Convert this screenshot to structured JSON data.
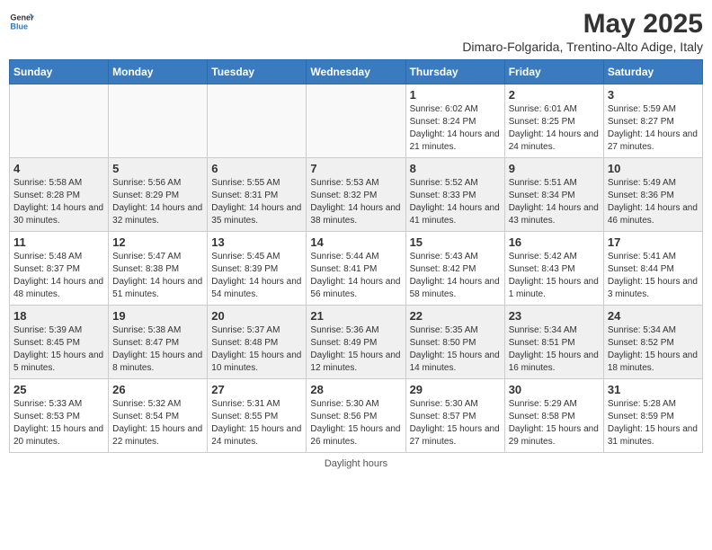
{
  "header": {
    "logo_general": "General",
    "logo_blue": "Blue",
    "title": "May 2025",
    "subtitle": "Dimaro-Folgarida, Trentino-Alto Adige, Italy"
  },
  "days_of_week": [
    "Sunday",
    "Monday",
    "Tuesday",
    "Wednesday",
    "Thursday",
    "Friday",
    "Saturday"
  ],
  "footer": "Daylight hours",
  "weeks": [
    [
      {
        "day": "",
        "info": ""
      },
      {
        "day": "",
        "info": ""
      },
      {
        "day": "",
        "info": ""
      },
      {
        "day": "",
        "info": ""
      },
      {
        "day": "1",
        "info": "Sunrise: 6:02 AM\nSunset: 8:24 PM\nDaylight: 14 hours and 21 minutes."
      },
      {
        "day": "2",
        "info": "Sunrise: 6:01 AM\nSunset: 8:25 PM\nDaylight: 14 hours and 24 minutes."
      },
      {
        "day": "3",
        "info": "Sunrise: 5:59 AM\nSunset: 8:27 PM\nDaylight: 14 hours and 27 minutes."
      }
    ],
    [
      {
        "day": "4",
        "info": "Sunrise: 5:58 AM\nSunset: 8:28 PM\nDaylight: 14 hours and 30 minutes."
      },
      {
        "day": "5",
        "info": "Sunrise: 5:56 AM\nSunset: 8:29 PM\nDaylight: 14 hours and 32 minutes."
      },
      {
        "day": "6",
        "info": "Sunrise: 5:55 AM\nSunset: 8:31 PM\nDaylight: 14 hours and 35 minutes."
      },
      {
        "day": "7",
        "info": "Sunrise: 5:53 AM\nSunset: 8:32 PM\nDaylight: 14 hours and 38 minutes."
      },
      {
        "day": "8",
        "info": "Sunrise: 5:52 AM\nSunset: 8:33 PM\nDaylight: 14 hours and 41 minutes."
      },
      {
        "day": "9",
        "info": "Sunrise: 5:51 AM\nSunset: 8:34 PM\nDaylight: 14 hours and 43 minutes."
      },
      {
        "day": "10",
        "info": "Sunrise: 5:49 AM\nSunset: 8:36 PM\nDaylight: 14 hours and 46 minutes."
      }
    ],
    [
      {
        "day": "11",
        "info": "Sunrise: 5:48 AM\nSunset: 8:37 PM\nDaylight: 14 hours and 48 minutes."
      },
      {
        "day": "12",
        "info": "Sunrise: 5:47 AM\nSunset: 8:38 PM\nDaylight: 14 hours and 51 minutes."
      },
      {
        "day": "13",
        "info": "Sunrise: 5:45 AM\nSunset: 8:39 PM\nDaylight: 14 hours and 54 minutes."
      },
      {
        "day": "14",
        "info": "Sunrise: 5:44 AM\nSunset: 8:41 PM\nDaylight: 14 hours and 56 minutes."
      },
      {
        "day": "15",
        "info": "Sunrise: 5:43 AM\nSunset: 8:42 PM\nDaylight: 14 hours and 58 minutes."
      },
      {
        "day": "16",
        "info": "Sunrise: 5:42 AM\nSunset: 8:43 PM\nDaylight: 15 hours and 1 minute."
      },
      {
        "day": "17",
        "info": "Sunrise: 5:41 AM\nSunset: 8:44 PM\nDaylight: 15 hours and 3 minutes."
      }
    ],
    [
      {
        "day": "18",
        "info": "Sunrise: 5:39 AM\nSunset: 8:45 PM\nDaylight: 15 hours and 5 minutes."
      },
      {
        "day": "19",
        "info": "Sunrise: 5:38 AM\nSunset: 8:47 PM\nDaylight: 15 hours and 8 minutes."
      },
      {
        "day": "20",
        "info": "Sunrise: 5:37 AM\nSunset: 8:48 PM\nDaylight: 15 hours and 10 minutes."
      },
      {
        "day": "21",
        "info": "Sunrise: 5:36 AM\nSunset: 8:49 PM\nDaylight: 15 hours and 12 minutes."
      },
      {
        "day": "22",
        "info": "Sunrise: 5:35 AM\nSunset: 8:50 PM\nDaylight: 15 hours and 14 minutes."
      },
      {
        "day": "23",
        "info": "Sunrise: 5:34 AM\nSunset: 8:51 PM\nDaylight: 15 hours and 16 minutes."
      },
      {
        "day": "24",
        "info": "Sunrise: 5:34 AM\nSunset: 8:52 PM\nDaylight: 15 hours and 18 minutes."
      }
    ],
    [
      {
        "day": "25",
        "info": "Sunrise: 5:33 AM\nSunset: 8:53 PM\nDaylight: 15 hours and 20 minutes."
      },
      {
        "day": "26",
        "info": "Sunrise: 5:32 AM\nSunset: 8:54 PM\nDaylight: 15 hours and 22 minutes."
      },
      {
        "day": "27",
        "info": "Sunrise: 5:31 AM\nSunset: 8:55 PM\nDaylight: 15 hours and 24 minutes."
      },
      {
        "day": "28",
        "info": "Sunrise: 5:30 AM\nSunset: 8:56 PM\nDaylight: 15 hours and 26 minutes."
      },
      {
        "day": "29",
        "info": "Sunrise: 5:30 AM\nSunset: 8:57 PM\nDaylight: 15 hours and 27 minutes."
      },
      {
        "day": "30",
        "info": "Sunrise: 5:29 AM\nSunset: 8:58 PM\nDaylight: 15 hours and 29 minutes."
      },
      {
        "day": "31",
        "info": "Sunrise: 5:28 AM\nSunset: 8:59 PM\nDaylight: 15 hours and 31 minutes."
      }
    ]
  ]
}
